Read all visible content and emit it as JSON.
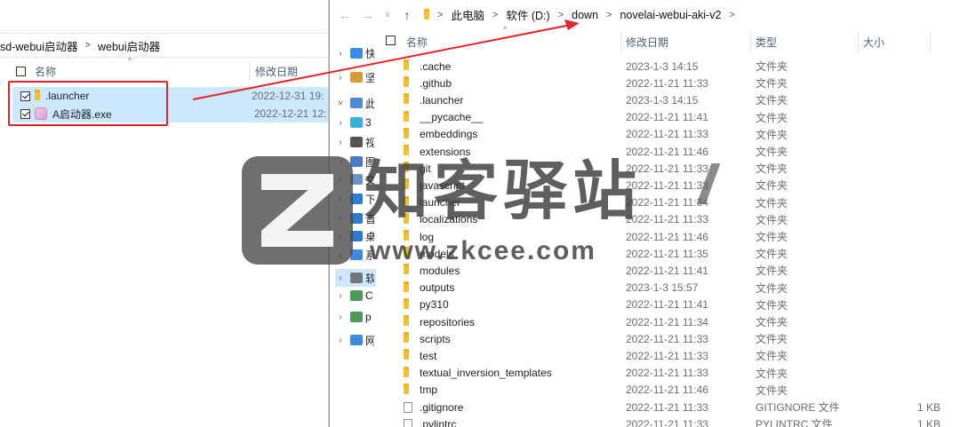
{
  "left_window": {
    "breadcrumb": [
      "sd-webui启动器",
      "webui启动器"
    ],
    "columns": {
      "name": "名称",
      "date": "修改日期"
    },
    "rows": [
      {
        "name": ".launcher",
        "date": "2022-12-31 19:",
        "icon": "folder-icon"
      },
      {
        "name": "A启动器.exe",
        "date": "2022-12-21 12:",
        "icon": "exe-icon"
      }
    ]
  },
  "right_window": {
    "breadcrumb": [
      "此电脑",
      "软件 (D:)",
      "down",
      "novelai-webui-aki-v2"
    ],
    "nav_items": [
      {
        "label": "快",
        "icon": "star-icon",
        "color": "#3c8be0"
      },
      {
        "label": "坚",
        "icon": "nut-icon",
        "color": "#d69b35"
      },
      {
        "label": "此",
        "icon": "computer-icon",
        "color": "#4a8ad6"
      },
      {
        "label": "3",
        "icon": "cube-icon",
        "color": "#3ab0d8"
      },
      {
        "label": "视",
        "icon": "video-icon",
        "color": "#555555"
      },
      {
        "label": "图",
        "icon": "picture-icon",
        "color": "#4a7cc6"
      },
      {
        "label": "文",
        "icon": "document-icon",
        "color": "#6a8fc2"
      },
      {
        "label": "下",
        "icon": "download-icon",
        "color": "#2d7ad6"
      },
      {
        "label": "音",
        "icon": "music-icon",
        "color": "#2d7ad6"
      },
      {
        "label": "桌",
        "icon": "desktop-icon",
        "color": "#2d7ad6"
      },
      {
        "label": "系",
        "icon": "windows-drive-icon",
        "color": "#3c8be0"
      },
      {
        "label": "软",
        "icon": "drive-icon",
        "color": "#777777"
      },
      {
        "label": "C",
        "icon": "drive-icon",
        "color": "#4c9a5a"
      },
      {
        "label": "p",
        "icon": "drive-icon",
        "color": "#4c9a5a"
      },
      {
        "label": "网",
        "icon": "network-icon",
        "color": "#3c8be0"
      }
    ],
    "columns": {
      "name": "名称",
      "date": "修改日期",
      "type": "类型",
      "size": "大小"
    },
    "rows": [
      {
        "name": ".cache",
        "date": "2023-1-3 14:15",
        "type": "文件夹",
        "size": "",
        "icon": "folder-icon"
      },
      {
        "name": ".github",
        "date": "2022-11-21 11:33",
        "type": "文件夹",
        "size": "",
        "icon": "folder-icon"
      },
      {
        "name": ".launcher",
        "date": "2023-1-3 14:15",
        "type": "文件夹",
        "size": "",
        "icon": "folder-icon"
      },
      {
        "name": "__pycache__",
        "date": "2022-11-21 11:41",
        "type": "文件夹",
        "size": "",
        "icon": "folder-icon"
      },
      {
        "name": "embeddings",
        "date": "2022-11-21 11:33",
        "type": "文件夹",
        "size": "",
        "icon": "folder-icon"
      },
      {
        "name": "extensions",
        "date": "2022-11-21 11:46",
        "type": "文件夹",
        "size": "",
        "icon": "folder-icon"
      },
      {
        "name": "git",
        "date": "2022-11-21 11:33",
        "type": "文件夹",
        "size": "",
        "icon": "folder-icon"
      },
      {
        "name": "javascript",
        "date": "2022-11-21 11:33",
        "type": "文件夹",
        "size": "",
        "icon": "folder-icon"
      },
      {
        "name": "launcher",
        "date": "2022-11-21 11:34",
        "type": "文件夹",
        "size": "",
        "icon": "folder-icon"
      },
      {
        "name": "localizations",
        "date": "2022-11-21 11:33",
        "type": "文件夹",
        "size": "",
        "icon": "folder-icon"
      },
      {
        "name": "log",
        "date": "2022-11-21 11:46",
        "type": "文件夹",
        "size": "",
        "icon": "folder-icon"
      },
      {
        "name": "models",
        "date": "2022-11-21 11:35",
        "type": "文件夹",
        "size": "",
        "icon": "folder-icon"
      },
      {
        "name": "modules",
        "date": "2022-11-21 11:41",
        "type": "文件夹",
        "size": "",
        "icon": "folder-icon"
      },
      {
        "name": "outputs",
        "date": "2023-1-3 15:57",
        "type": "文件夹",
        "size": "",
        "icon": "folder-icon"
      },
      {
        "name": "py310",
        "date": "2022-11-21 11:41",
        "type": "文件夹",
        "size": "",
        "icon": "folder-icon"
      },
      {
        "name": "repositories",
        "date": "2022-11-21 11:34",
        "type": "文件夹",
        "size": "",
        "icon": "folder-icon"
      },
      {
        "name": "scripts",
        "date": "2022-11-21 11:33",
        "type": "文件夹",
        "size": "",
        "icon": "folder-icon"
      },
      {
        "name": "test",
        "date": "2022-11-21 11:33",
        "type": "文件夹",
        "size": "",
        "icon": "folder-icon"
      },
      {
        "name": "textual_inversion_templates",
        "date": "2022-11-21 11:33",
        "type": "文件夹",
        "size": "",
        "icon": "folder-icon"
      },
      {
        "name": "tmp",
        "date": "2022-11-21 11:46",
        "type": "文件夹",
        "size": "",
        "icon": "folder-icon"
      },
      {
        "name": ".gitignore",
        "date": "2022-11-21 11:33",
        "type": "GITIGNORE 文件",
        "size": "1 KB",
        "icon": "file-icon"
      },
      {
        "name": ".pylintrc",
        "date": "2022-11-21 11:33",
        "type": "PYLINTRC 文件",
        "size": "1 KB",
        "icon": "file-icon"
      }
    ]
  },
  "watermark": {
    "title": "知客驿站",
    "url": "www.zkcee.com"
  },
  "colors": {
    "selection": "#cce8ff",
    "highlight_box": "#e0252b",
    "folder": "#f4c53d"
  }
}
